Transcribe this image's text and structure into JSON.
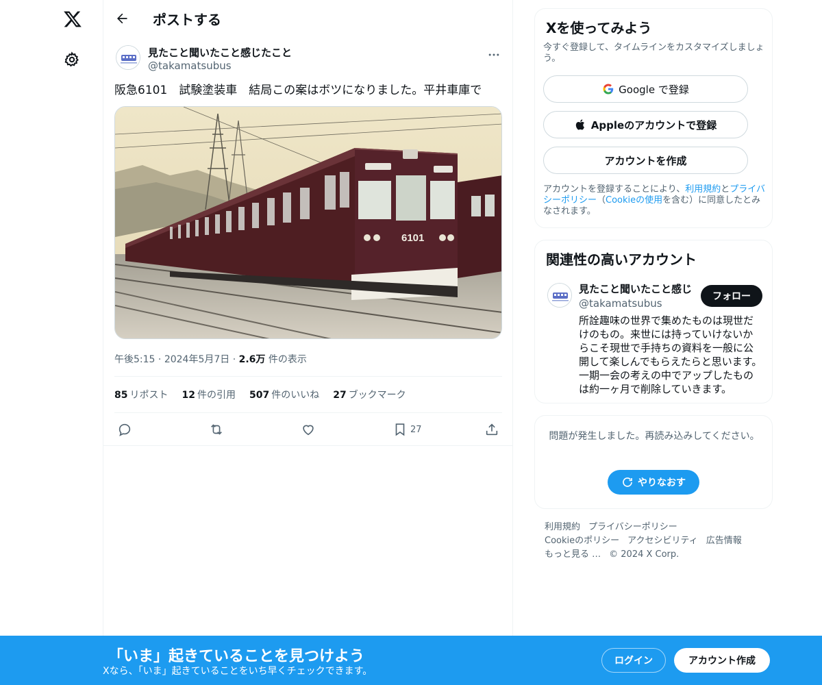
{
  "nav": {
    "logo_icon": "x-logo-icon",
    "settings_icon": "gear-icon"
  },
  "header": {
    "title": "ポストする",
    "back_icon": "arrow-left-icon"
  },
  "post": {
    "author_name": "見たこと聞いたこと感じたこと",
    "author_handle": "@takamatsubus",
    "text": "阪急6101　試験塗装車　結局この案はボツになりました。平井車庫で",
    "time": "午後5:15",
    "date": "2024年5月7日",
    "views_count": "2.6万",
    "views_label": "件の表示",
    "stats": [
      {
        "count": "85",
        "label": "リポスト"
      },
      {
        "count": "12",
        "label": "件の引用"
      },
      {
        "count": "507",
        "label": "件のいいね"
      },
      {
        "count": "27",
        "label": "ブックマーク"
      }
    ],
    "actions": {
      "reply_icon": "reply-icon",
      "repost_icon": "repost-icon",
      "like_icon": "heart-icon",
      "bookmark_icon": "bookmark-icon",
      "bookmark_count": "27",
      "share_icon": "share-icon"
    },
    "media": {
      "train_number": "6101"
    }
  },
  "signup_card": {
    "title": "Xを使ってみよう",
    "subtitle": "今すぐ登録して、タイムラインをカスタマイズしましょう。",
    "google_label": "Google で登録",
    "apple_label": "Appleのアカウントで登録",
    "create_label": "アカウントを作成",
    "terms_prefix": "アカウントを登録することにより、",
    "terms_link": "利用規約",
    "terms_and": "と",
    "privacy_link": "プライバシーポリシー",
    "terms_open": "（",
    "cookie_link": "Cookieの使用",
    "terms_suffix": "を含む）に同意したとみなされます。"
  },
  "related": {
    "title": "関連性の高いアカウント",
    "name": "見たこと聞いたこと感じ",
    "handle": "@takamatsubus",
    "follow_label": "フォロー",
    "bio": "所詮趣味の世界で集めたものは現世だけのもの。来世には持っていけないからこそ現世で手持ちの資料を一般に公開して楽しんでもらえたらと思います。一期一会の考えの中でアップしたものは約一ヶ月で削除していきます。"
  },
  "error_card": {
    "message": "問題が発生しました。再読み込みしてください。",
    "retry_label": "やりなおす"
  },
  "footer": {
    "links": [
      "利用規約",
      "プライバシーポリシー",
      "Cookieのポリシー",
      "アクセシビリティ",
      "広告情報",
      "もっと見る …",
      "© 2024 X Corp."
    ]
  },
  "banner": {
    "title": "「いま」起きていることを見つけよう",
    "subtitle": "Xなら、「いま」起きていることをいち早くチェックできます。",
    "login_label": "ログイン",
    "signup_label": "アカウント作成"
  },
  "colors": {
    "accent": "#1d9bf0",
    "text": "#0f1419",
    "muted": "#536471",
    "border": "#eff3f4"
  }
}
